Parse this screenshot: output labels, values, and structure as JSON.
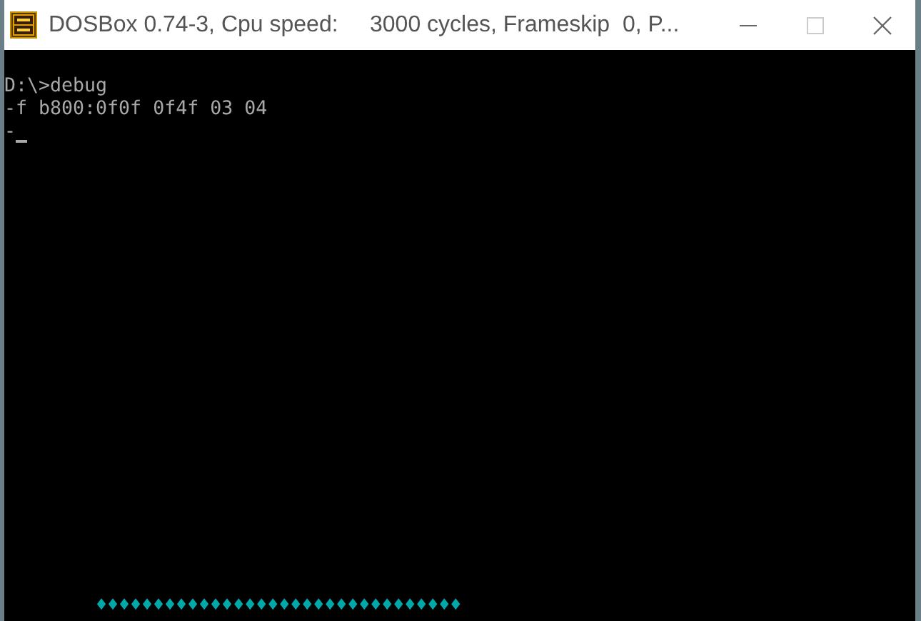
{
  "window": {
    "title": "DOSBox 0.74-3, Cpu speed:     3000 cycles, Frameskip  0, P..."
  },
  "console": {
    "lines": [
      {
        "text": "D:\\>debug"
      },
      {
        "text": "-f b800:0f0f 0f4f 03 04"
      },
      {
        "text": "-",
        "cursor": true
      }
    ],
    "bottom_row": {
      "text": "♦♦♦♦♦♦♦♦♦♦♦♦♦♦♦♦♦♦♦♦♦♦♦♦♦♦♦♦♦♦♦♦",
      "color": "#00a8a8"
    }
  }
}
